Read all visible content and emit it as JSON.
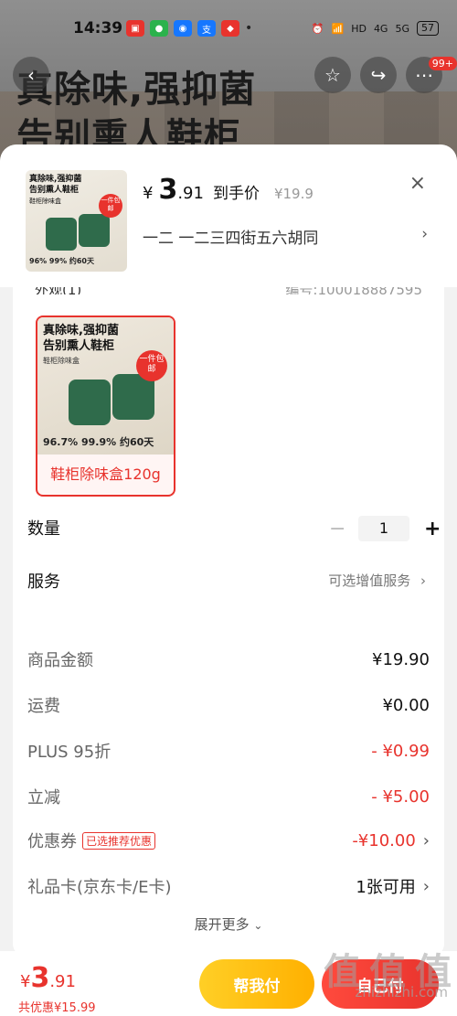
{
  "status_bar": {
    "time": "14:39",
    "network": "4G",
    "network2": "5G",
    "battery": "57"
  },
  "background": {
    "headline_line1": "真除味,强抑菌",
    "headline_line2": "告别熏人鞋柜",
    "badge": "99+"
  },
  "header": {
    "yen": "¥",
    "price_int": "3",
    "price_dec": ".91",
    "price_tag": "到手价",
    "original_price": "¥19.9",
    "close": "×",
    "address": "一二  一二三四街五六胡同",
    "address_arrow": "›"
  },
  "thumb": {
    "line1": "真除味,强抑菌",
    "line2": "告别熏人鞋柜",
    "sub": "鞋柜除味盒",
    "promo": "一件包邮",
    "stats": "96% 99% 约60天"
  },
  "spec": {
    "label_cut": "外观(1)",
    "code_cut": "编号:100018887595",
    "variant": {
      "line1": "真除味,强抑菌",
      "line2": "告别熏人鞋柜",
      "sub": "鞋柜除味盒",
      "promo": "一件包邮",
      "stats": "96.7% 99.9% 约60天",
      "label": "鞋柜除味盒120g"
    }
  },
  "quantity": {
    "label": "数量",
    "minus": "−",
    "value": "1",
    "plus": "+"
  },
  "service": {
    "label": "服务",
    "value": "可选增值服务",
    "arrow": "›"
  },
  "summary": {
    "rows": [
      {
        "key": "商品金额",
        "value": "¥19.90"
      },
      {
        "key": "运费",
        "value": "¥0.00"
      },
      {
        "key": "PLUS 95折",
        "value": "- ¥0.99"
      },
      {
        "key": "立减",
        "value": "- ¥5.00"
      },
      {
        "key": "优惠券",
        "chip": "已选推荐优惠",
        "value": "-¥10.00",
        "arrow": "›"
      },
      {
        "key": "礼品卡(京东卡/E卡)",
        "value": "1张可用",
        "arrow": "›"
      }
    ],
    "more": "展开更多"
  },
  "bottom": {
    "yen": "¥",
    "price_int": "3",
    "price_dec": ".91",
    "saved": "共优惠¥15.99",
    "help_pay": "帮我付",
    "self_pay": "自己付"
  },
  "watermark": {
    "logo": "值 值 值",
    "site": "zhizhizhi.com"
  },
  "colors": {
    "accent": "#e8332d",
    "gold": "#ffb000"
  }
}
